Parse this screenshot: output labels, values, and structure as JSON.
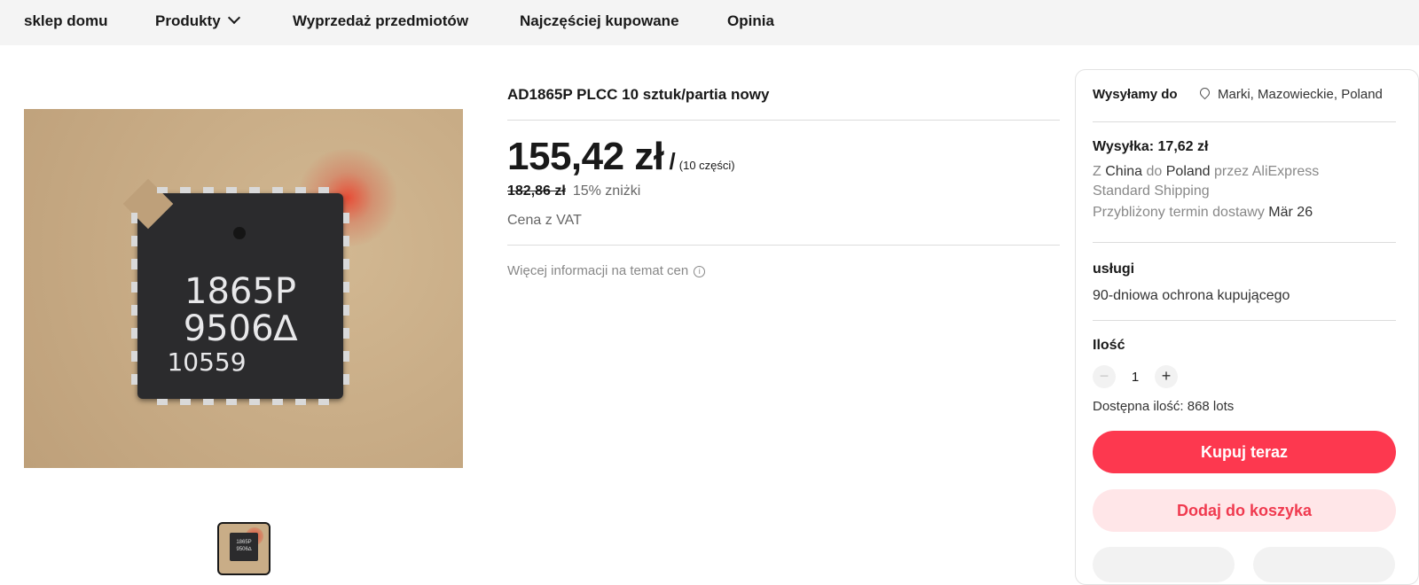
{
  "nav": {
    "items": [
      {
        "label": "sklep domu"
      },
      {
        "label": "Produkty"
      },
      {
        "label": "Wyprzedaż przedmiotów"
      },
      {
        "label": "Najczęściej kupowane"
      },
      {
        "label": "Opinia"
      }
    ]
  },
  "gallery": {
    "chip_text": [
      "1865P",
      "9506∆",
      "10559"
    ]
  },
  "product": {
    "title": "AD1865P PLCC 10 sztuk/partia nowy",
    "price": "155,42 zł",
    "price_separator": "/",
    "price_unit": "(10 części)",
    "old_price": "182,86 zł",
    "discount": "15% zniżki",
    "vat": "Cena z VAT",
    "more_info": "Więcej informacji na temat cen",
    "info_icon": "ⓘ"
  },
  "panel": {
    "ship_to_label": "Wysyłamy do",
    "location": "Marki, Mazowieckie, Poland",
    "shipping_cost": "Wysyłka: 17,62 zł",
    "route": {
      "from_prefix": "Z",
      "from": "China",
      "to_prefix": "do",
      "to": "Poland",
      "via_prefix": "przez",
      "via": "AliExpress Standard Shipping"
    },
    "delivery_label": "Przybliżony termin dostawy",
    "delivery_date": "Mär 26",
    "services_title": "usługi",
    "services_text": "90-dniowa ochrona kupującego",
    "quantity_title": "Ilość",
    "quantity_minus": "−",
    "quantity_value": "1",
    "quantity_plus": "+",
    "available": "Dostępna ilość: 868 lots",
    "buy_now": "Kupuj teraz",
    "add_to_cart": "Dodaj do koszyka"
  },
  "colors": {
    "accent": "#fd384f",
    "accent_light": "#ffe6e8",
    "nav_bg": "#f4f4f4"
  },
  "icons": [
    "chevron-down-icon",
    "location-pin-icon",
    "info-icon",
    "minus-icon",
    "plus-icon"
  ]
}
